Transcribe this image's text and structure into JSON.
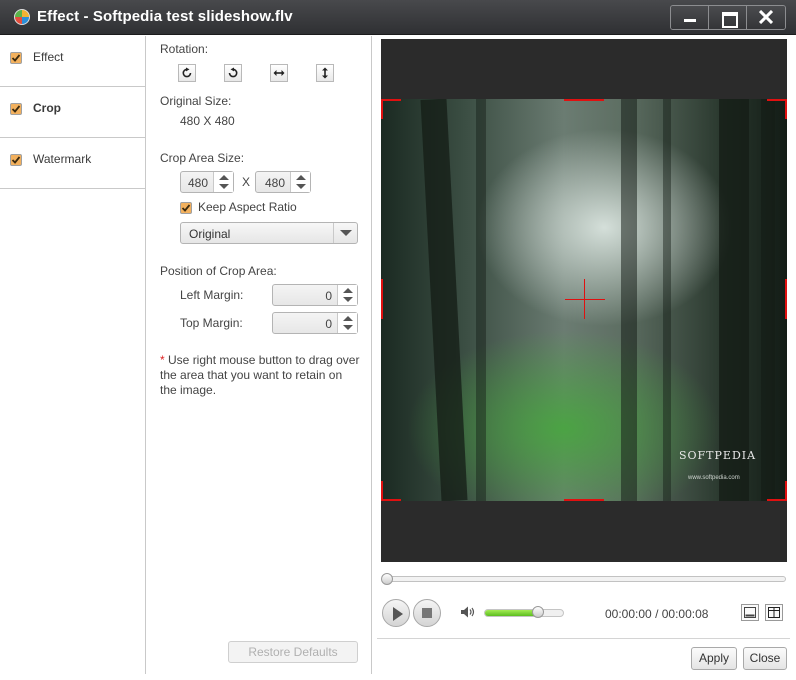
{
  "window": {
    "title": "Effect - Softpedia test slideshow.flv"
  },
  "nav": {
    "items": [
      {
        "label": "Effect",
        "checked": true,
        "active": false
      },
      {
        "label": "Crop",
        "checked": true,
        "active": true
      },
      {
        "label": "Watermark",
        "checked": true,
        "active": false
      }
    ]
  },
  "crop": {
    "rotation_label": "Rotation:",
    "original_size_label": "Original Size:",
    "original_size_value": "480 X 480",
    "crop_area_size_label": "Crop Area Size:",
    "width": "480",
    "times": "X",
    "height": "480",
    "keep_aspect_label": "Keep Aspect Ratio",
    "keep_aspect_checked": true,
    "aspect_selected": "Original",
    "position_label": "Position of Crop Area:",
    "left_margin_label": "Left Margin:",
    "left_margin_value": "0",
    "top_margin_label": "Top Margin:",
    "top_margin_value": "0",
    "note_star": "*",
    "note_text": "Use right mouse button to drag over the area that you want to retain on the image.",
    "restore_label": "Restore Defaults"
  },
  "preview": {
    "watermark_brand": "SOFTPEDIA",
    "watermark_url": "www.softpedia.com",
    "seek_progress": 0,
    "volume_level": 0.68,
    "time_current": "00:00:00",
    "time_separator": "/",
    "time_total": "00:00:08"
  },
  "buttons": {
    "apply": "Apply",
    "close": "Close"
  },
  "colors": {
    "crop_guide": "#e01010",
    "volume_fill": "#7ad43a",
    "title_bar": "#3a3b3e"
  }
}
